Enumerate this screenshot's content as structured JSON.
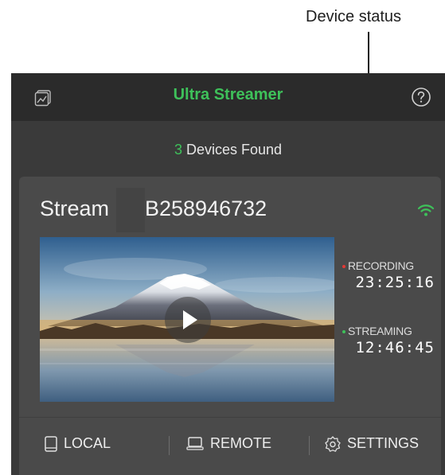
{
  "annotation": {
    "label": "Device status"
  },
  "app": {
    "title": "Ultra Streamer",
    "devices_found": {
      "count": "3",
      "suffix": "Devices Found"
    }
  },
  "device": {
    "name": "Stream",
    "id": "B258946732"
  },
  "status": {
    "recording": {
      "label": "RECORDING",
      "time": "23:25:16",
      "color": "#e53935"
    },
    "streaming": {
      "label": "STREAMING",
      "time": "12:46:45",
      "color": "#3ec15a"
    }
  },
  "nav": {
    "local": "LOCAL",
    "remote": "REMOTE",
    "settings": "SETTINGS"
  },
  "colors": {
    "accent": "#3ec15a",
    "record": "#e53935"
  },
  "icons": [
    "gallery-icon",
    "help-icon",
    "wifi-icon",
    "play-icon",
    "phone-icon",
    "laptop-icon",
    "gear-icon"
  ]
}
